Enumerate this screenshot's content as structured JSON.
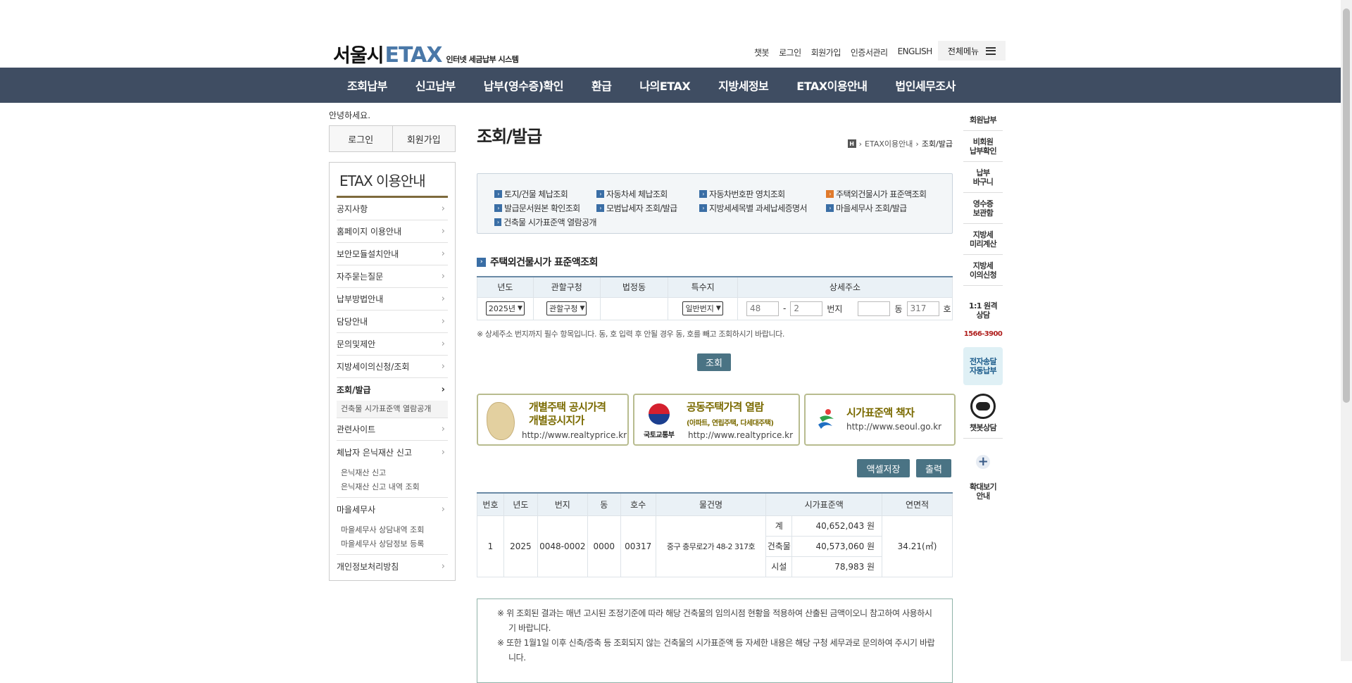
{
  "header": {
    "logo_city": "서울시",
    "logo_etax": "ETAX",
    "logo_sub": "인터넷 세금납부 시스템",
    "util_links": [
      "챗봇",
      "로그인",
      "회원가입",
      "인증서관리",
      "ENGLISH"
    ],
    "all_menu": "전체메뉴"
  },
  "gnb": [
    "조회납부",
    "신고납부",
    "납부(영수증)확인",
    "환급",
    "나의ETAX",
    "지방세정보",
    "ETAX이용안내",
    "법인세무조사"
  ],
  "left": {
    "greeting": "안녕하세요.",
    "login": "로그인",
    "signup": "회원가입",
    "title": "ETAX 이용안내",
    "items": [
      "공지사항",
      "홈페이지 이용안내",
      "보안모듈설치안내",
      "자주묻는질문",
      "납부방법안내",
      "담당안내",
      "문의및제안",
      "지방세이의신청/조회",
      "조회/발급"
    ],
    "sub_view": [
      "건축물 시가표준액 열람공개"
    ],
    "items2": [
      "관련사이트",
      "체납자 은닉재산 신고"
    ],
    "sub_hidden": [
      "은닉재산 신고",
      "은닉재산 신고 내역 조회"
    ],
    "items3": [
      "마을세무사"
    ],
    "sub_village": [
      "마을세무사 상담내역 조회",
      "마을세무사 상담정보 등록"
    ],
    "items4": [
      "개인정보처리방침"
    ]
  },
  "main": {
    "title": "조회/발급",
    "breadcrumb": [
      "ETAX이용안내",
      "조회/발급"
    ],
    "quick_links": [
      "토지/건물 체납조회",
      "자동차세 체납조회",
      "자동차번호판 영치조회",
      "주택외건물시가 표준액조회",
      "발급문서원본 확인조회",
      "모범납세자 조회/발급",
      "지방세세목별 과세납세증명서",
      "마을세무사 조회/발급",
      "건축물 시가표준액 열람공개"
    ],
    "section_title": "주택외건물시가 표준액조회",
    "search_headers": [
      "년도",
      "관할구청",
      "법정동",
      "특수지",
      "상세주소"
    ],
    "search": {
      "year": "2025년",
      "district": "관할구청",
      "special": "일반번지",
      "bonbun": "48",
      "bubun": "2",
      "bunji_label": "번지",
      "dong_value": "",
      "dong_label": "동",
      "ho_value": "317",
      "ho_label": "호",
      "dash": "-"
    },
    "note": "※ 상세주소 번지까지 필수 항목입니다. 동, 호 입력 후 안될 경우 동, 호를 빼고 조회하시기 바랍니다.",
    "search_button": "조회",
    "banners": {
      "b1_line1": "개별주택 공시가격",
      "b1_line2": "개별공시지가",
      "b1_url": "http://www.realtyprice.kr",
      "b2_title": "공동주택가격 열람",
      "b2_sub": "(아파트, 연립주택, 다세대주택)",
      "b2_org": "국토교통부",
      "b2_url": "http://www.realtyprice.kr",
      "b3_title": "시가표준액 책자",
      "b3_url": "http://www.seoul.go.kr"
    },
    "excel_button": "액셀저장",
    "print_button": "출력",
    "result_headers": [
      "번호",
      "년도",
      "번지",
      "동",
      "호수",
      "물건명",
      "시가표준액",
      "연면적"
    ],
    "result": {
      "no": "1",
      "year": "2025",
      "bunji": "0048-0002",
      "dong": "0000",
      "ho": "00317",
      "name": "중구 충무로2가 48-2 317호",
      "rows": [
        {
          "label": "계",
          "amount": "40,652,043 원"
        },
        {
          "label": "건축물",
          "amount": "40,573,060 원"
        },
        {
          "label": "시설",
          "amount": "78,983 원"
        }
      ],
      "area": "34.21(㎡)"
    },
    "notices": [
      "※ 위 조회된 결과는 매년 고시된 조정기준에 따라 해당 건축물의 임의시점 현황을 적용하여 산출된 금액이오니 참고하여 사용하시기 바랍니다.",
      "※ 또한 1월1일 이후 신축/증축 등 조회되지 않는 건축물의 시가표준액 등 자세한 내용은 해당 구청 세무과로 문의하여 주시기 바랍니다."
    ]
  },
  "right_quick": {
    "items": [
      "회원납부",
      "비회원\n납부확인",
      "납부\n바구니",
      "영수증\n보관함",
      "지방세\n미리계산",
      "지방세\n이의신청"
    ],
    "consult": "1:1 원격\n상담",
    "phone": "1566-3900",
    "auto_pay": "전자송달\n자동납부",
    "chatbot": "챗봇상담",
    "zoom": "확대보기\n안내"
  }
}
